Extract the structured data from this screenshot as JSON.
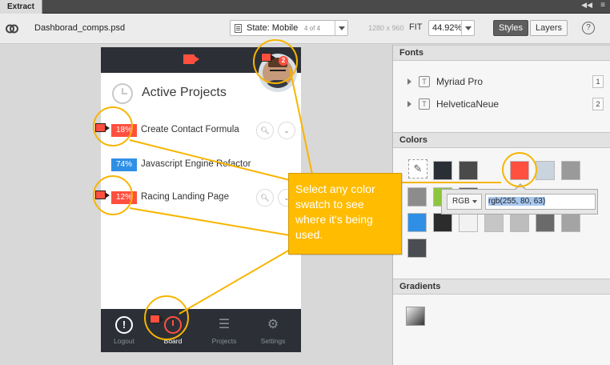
{
  "titlebar": {
    "tab": "Extract",
    "collapse_icon": "double-left-chevron",
    "menu_icon": "hamburger-icon"
  },
  "toolbar": {
    "filename": "Dashborad_comps.psd",
    "state_label": "State: Mobile",
    "state_count": "4 of 4",
    "dimensions": "1280 x 960",
    "fit_label": "FIT",
    "zoom_value": "44.92%",
    "styles_label": "Styles",
    "layers_label": "Layers",
    "help_label": "?"
  },
  "mockup": {
    "badge": "2",
    "title": "Active Projects",
    "rows": [
      {
        "percent": "18%",
        "title": "Create Contact Formula",
        "color": "#ff503f"
      },
      {
        "percent": "74%",
        "title": "Javascript Engine Refactor",
        "color": "#2f8fe6"
      },
      {
        "percent": "12%",
        "title": "Racing Landing Page",
        "color": "#ff503f"
      }
    ],
    "footer": [
      {
        "label": "Logout",
        "icon": "logout-icon"
      },
      {
        "label": "Board",
        "icon": "dashboard-icon"
      },
      {
        "label": "Projects",
        "icon": "projects-icon"
      },
      {
        "label": "Settings",
        "icon": "gear-icon"
      }
    ]
  },
  "callout": {
    "text": "Select any color swatch to see where it's being used."
  },
  "panel": {
    "fonts_header": "Fonts",
    "fonts": [
      {
        "name": "Myriad Pro",
        "count": "1"
      },
      {
        "name": "HelveticaNeue",
        "count": "2"
      }
    ],
    "colors_header": "Colors",
    "swatches": [
      "#2a2f36",
      "#4a4a4a",
      "#ff503f",
      "#c9d4df",
      "#9a9a9a",
      "#8c8c8c",
      "#8cc63f",
      "#5a5a5a",
      "#2f8fe6",
      "#2c2c2c",
      "#f2f2f2",
      "#c6c6c6",
      "#bdbdbd",
      "#6a6a6a",
      "#a4a4a4",
      "#4a4d52"
    ],
    "color_mode": "RGB",
    "color_value": "rgb(255, 80, 63)",
    "gradients_header": "Gradients"
  }
}
